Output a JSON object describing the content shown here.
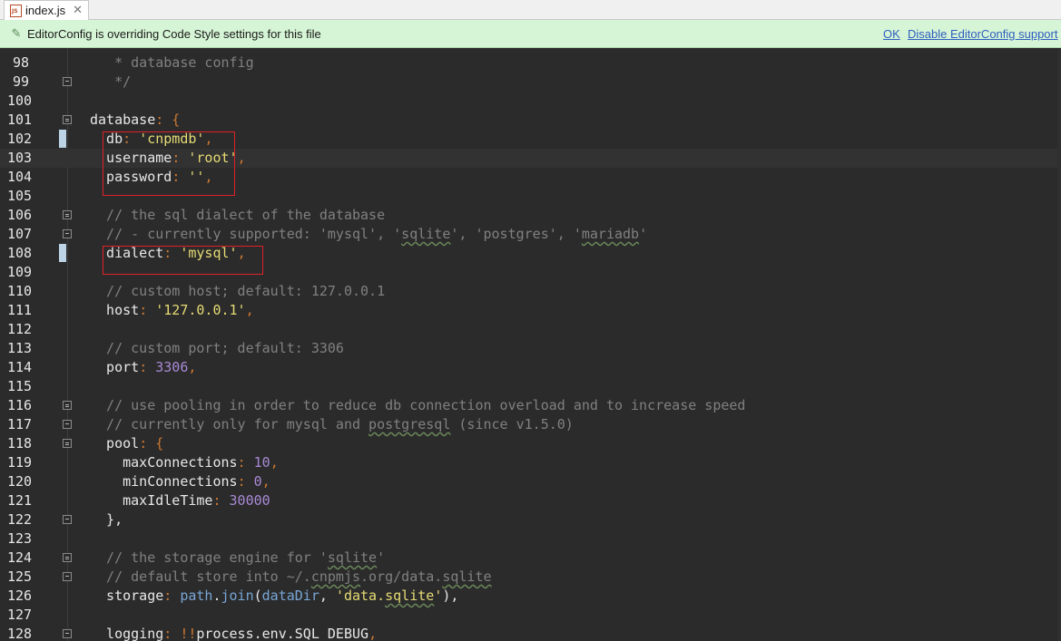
{
  "tab": {
    "label": "index.js",
    "close_glyph": "✕",
    "icon": "js-file-icon"
  },
  "banner": {
    "icon": "editorconfig-icon",
    "message": "EditorConfig is overriding Code Style settings for this file",
    "ok_label": "OK",
    "disable_label": "Disable EditorConfig support"
  },
  "editor": {
    "lines": [
      {
        "num": "98",
        "tokens": [
          {
            "t": "   * database config",
            "c": "comment"
          }
        ]
      },
      {
        "num": "99",
        "tokens": [
          {
            "t": "   */",
            "c": "comment"
          }
        ]
      },
      {
        "num": "100",
        "tokens": []
      },
      {
        "num": "101",
        "tokens": [
          {
            "t": "database",
            "c": "key"
          },
          {
            "t": ": {",
            "c": "punct"
          }
        ]
      },
      {
        "num": "102",
        "tokens": [
          {
            "t": "  db",
            "c": "key"
          },
          {
            "t": ": ",
            "c": "punct"
          },
          {
            "t": "'cnpmdb'",
            "c": "str"
          },
          {
            "t": ",",
            "c": "punct"
          }
        ]
      },
      {
        "num": "103",
        "tokens": [
          {
            "t": "  username",
            "c": "key"
          },
          {
            "t": ": ",
            "c": "punct"
          },
          {
            "t": "'root'",
            "c": "str"
          },
          {
            "t": ",",
            "c": "punct"
          }
        ]
      },
      {
        "num": "104",
        "tokens": [
          {
            "t": "  password",
            "c": "key"
          },
          {
            "t": ": ",
            "c": "punct"
          },
          {
            "t": "''",
            "c": "str"
          },
          {
            "t": ",",
            "c": "punct"
          }
        ]
      },
      {
        "num": "105",
        "tokens": []
      },
      {
        "num": "106",
        "tokens": [
          {
            "t": "  // the sql dialect of the database",
            "c": "comment"
          }
        ]
      },
      {
        "num": "107",
        "tokens": [
          {
            "t": "  // - currently supported: 'mysql', '",
            "c": "comment"
          },
          {
            "t": "sqlite",
            "c": "comment",
            "squig": true
          },
          {
            "t": "', 'postgres', '",
            "c": "comment"
          },
          {
            "t": "mariadb",
            "c": "comment",
            "squig": true
          },
          {
            "t": "'",
            "c": "comment"
          }
        ]
      },
      {
        "num": "108",
        "tokens": [
          {
            "t": "  dialect",
            "c": "key"
          },
          {
            "t": ": ",
            "c": "punct"
          },
          {
            "t": "'mysql'",
            "c": "str"
          },
          {
            "t": ",",
            "c": "punct"
          }
        ]
      },
      {
        "num": "109",
        "tokens": []
      },
      {
        "num": "110",
        "tokens": [
          {
            "t": "  // custom host; default: 127.0.0.1",
            "c": "comment"
          }
        ]
      },
      {
        "num": "111",
        "tokens": [
          {
            "t": "  host",
            "c": "key"
          },
          {
            "t": ": ",
            "c": "punct"
          },
          {
            "t": "'127.0.0.1'",
            "c": "str"
          },
          {
            "t": ",",
            "c": "punct"
          }
        ]
      },
      {
        "num": "112",
        "tokens": []
      },
      {
        "num": "113",
        "tokens": [
          {
            "t": "  // custom port; default: 3306",
            "c": "comment"
          }
        ]
      },
      {
        "num": "114",
        "tokens": [
          {
            "t": "  port",
            "c": "key"
          },
          {
            "t": ": ",
            "c": "punct"
          },
          {
            "t": "3306",
            "c": "num"
          },
          {
            "t": ",",
            "c": "punct"
          }
        ]
      },
      {
        "num": "115",
        "tokens": []
      },
      {
        "num": "116",
        "tokens": [
          {
            "t": "  // use pooling in order to reduce db connection overload and to increase speed",
            "c": "comment"
          }
        ]
      },
      {
        "num": "117",
        "tokens": [
          {
            "t": "  // currently only for mysql and ",
            "c": "comment"
          },
          {
            "t": "postgresql",
            "c": "comment",
            "squig": true
          },
          {
            "t": " (since v1.5.0)",
            "c": "comment"
          }
        ]
      },
      {
        "num": "118",
        "tokens": [
          {
            "t": "  pool",
            "c": "key"
          },
          {
            "t": ": {",
            "c": "punct"
          }
        ]
      },
      {
        "num": "119",
        "tokens": [
          {
            "t": "    maxConnections",
            "c": "key"
          },
          {
            "t": ": ",
            "c": "punct"
          },
          {
            "t": "10",
            "c": "num"
          },
          {
            "t": ",",
            "c": "punct"
          }
        ]
      },
      {
        "num": "120",
        "tokens": [
          {
            "t": "    minConnections",
            "c": "key"
          },
          {
            "t": ": ",
            "c": "punct"
          },
          {
            "t": "0",
            "c": "num"
          },
          {
            "t": ",",
            "c": "punct"
          }
        ]
      },
      {
        "num": "121",
        "tokens": [
          {
            "t": "    maxIdleTime",
            "c": "key"
          },
          {
            "t": ": ",
            "c": "punct"
          },
          {
            "t": "30000",
            "c": "num"
          }
        ]
      },
      {
        "num": "122",
        "tokens": [
          {
            "t": "  },",
            "c": "plain"
          }
        ]
      },
      {
        "num": "123",
        "tokens": []
      },
      {
        "num": "124",
        "tokens": [
          {
            "t": "  // the storage engine for '",
            "c": "comment"
          },
          {
            "t": "sqlite",
            "c": "comment",
            "squig": true
          },
          {
            "t": "'",
            "c": "comment"
          }
        ]
      },
      {
        "num": "125",
        "tokens": [
          {
            "t": "  // default store into ~/.",
            "c": "comment"
          },
          {
            "t": "cnpmjs",
            "c": "comment",
            "squig": true
          },
          {
            "t": ".org/data.",
            "c": "comment"
          },
          {
            "t": "sqlite",
            "c": "comment",
            "squig": true
          }
        ]
      },
      {
        "num": "126",
        "tokens": [
          {
            "t": "  storage",
            "c": "key"
          },
          {
            "t": ": ",
            "c": "punct"
          },
          {
            "t": "path",
            "c": "fn"
          },
          {
            "t": ".",
            "c": "plain"
          },
          {
            "t": "join",
            "c": "fn"
          },
          {
            "t": "(",
            "c": "plain"
          },
          {
            "t": "dataDir",
            "c": "fn"
          },
          {
            "t": ", ",
            "c": "plain"
          },
          {
            "t": "'data.",
            "c": "str"
          },
          {
            "t": "sqlite",
            "c": "str",
            "squig": true
          },
          {
            "t": "'",
            "c": "str"
          },
          {
            "t": "),",
            "c": "plain"
          }
        ]
      },
      {
        "num": "127",
        "tokens": []
      },
      {
        "num": "128",
        "tokens": [
          {
            "t": "  logging",
            "c": "key"
          },
          {
            "t": ": ",
            "c": "punct"
          },
          {
            "t": "!!",
            "c": "punct"
          },
          {
            "t": "process.env.SQL_DEBUG",
            "c": "plain"
          },
          {
            "t": ",",
            "c": "punct"
          }
        ]
      }
    ],
    "current_line": "103",
    "changed_lines": [
      "102",
      "108"
    ],
    "fold_close_lines": [
      "99",
      "122",
      "125",
      "128"
    ],
    "fold_open_lines": [
      "101",
      "106",
      "116",
      "118",
      "124"
    ],
    "fold_mid_lines": [
      "107",
      "117"
    ]
  }
}
